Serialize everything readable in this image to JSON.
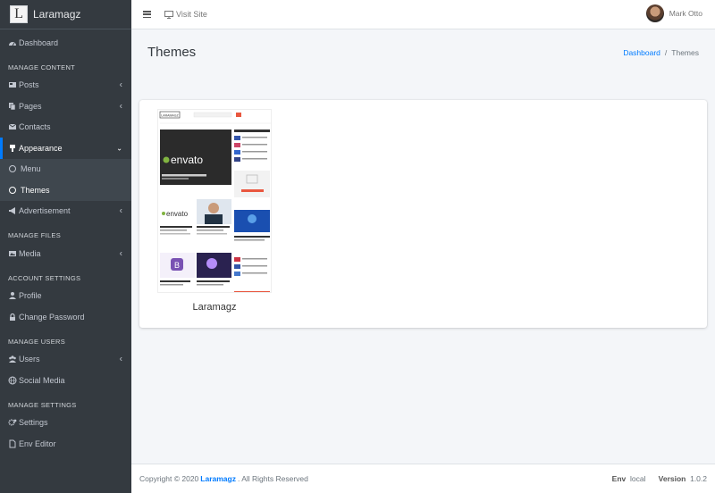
{
  "brand": {
    "logo_letter": "L",
    "name": "Laramagz"
  },
  "sidebar": {
    "dashboard": "Dashboard",
    "sections": {
      "content": "MANAGE CONTENT",
      "files": "MANAGE FILES",
      "account": "ACCOUNT SETTINGS",
      "users": "MANAGE USERS",
      "settings": "MANAGE SETTINGS"
    },
    "items": {
      "posts": "Posts",
      "pages": "Pages",
      "contacts": "Contacts",
      "appearance": "Appearance",
      "menu": "Menu",
      "themes": "Themes",
      "advertisement": "Advertisement",
      "media": "Media",
      "profile": "Profile",
      "change_password": "Change Password",
      "users": "Users",
      "social_media": "Social Media",
      "settings": "Settings",
      "env_editor": "Env Editor"
    }
  },
  "topbar": {
    "visit_site": "Visit Site",
    "user_name": "Mark Otto"
  },
  "header": {
    "title": "Themes"
  },
  "breadcrumb": {
    "home": "Dashboard",
    "separator": "/",
    "current": "Themes"
  },
  "themes": [
    {
      "name": "Laramagz",
      "preview": {
        "logo": "LARAMAGZ",
        "hero_brand": "envato",
        "card1_brand": "envato",
        "card3_letter": "B"
      }
    }
  ],
  "footer": {
    "copyright_prefix": "Copyright © 2020",
    "brand": "Laramagz",
    "copyright_suffix": ". All Rights Reserved",
    "env_label": "Env",
    "env_value": "local",
    "version_label": "Version",
    "version_value": "1.0.2"
  },
  "colors": {
    "sidebar_bg": "#343a40",
    "accent": "#007bff",
    "content_bg": "#f4f6f9"
  }
}
